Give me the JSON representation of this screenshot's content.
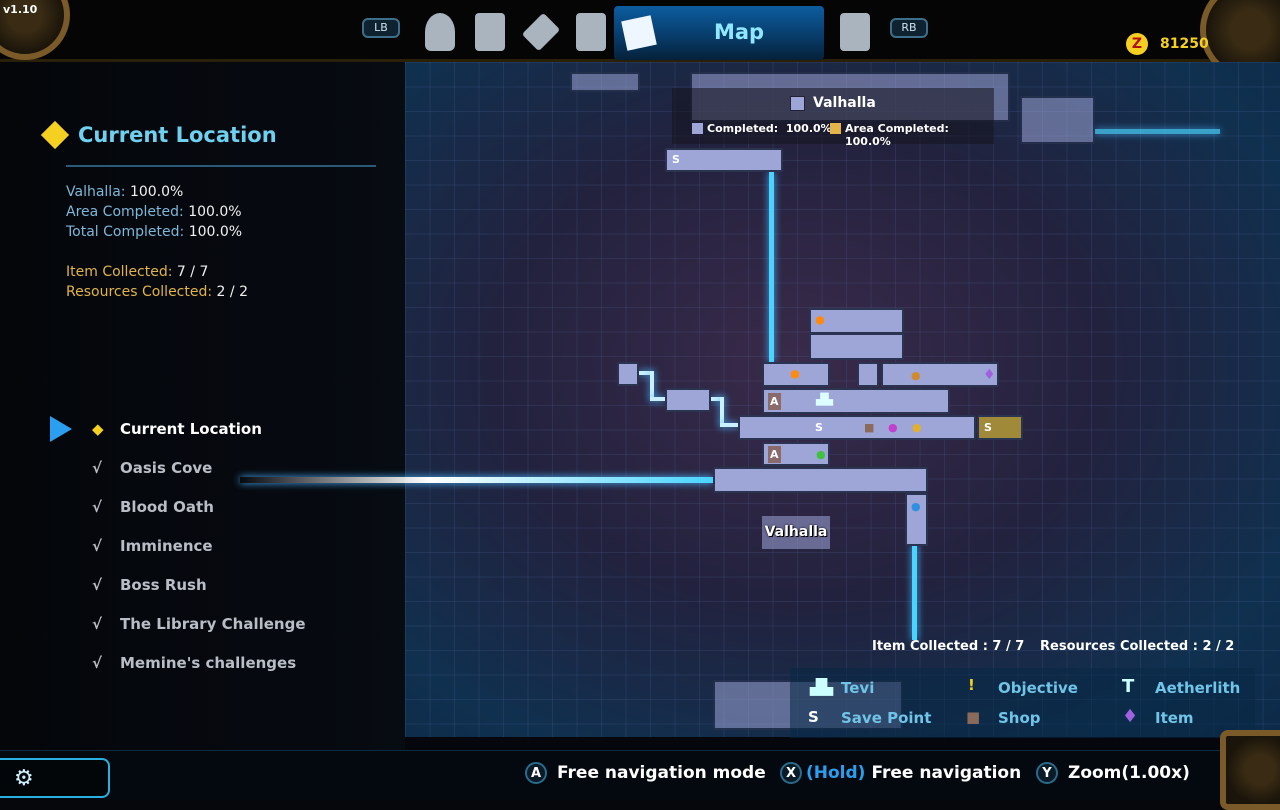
{
  "version": "v1.10",
  "nav": {
    "lb": "LB",
    "rb": "RB",
    "active_tab": "Map",
    "tabs": [
      "profile-icon",
      "skills-icon",
      "wrench-icon",
      "scroll-icon",
      "map-icon",
      "bestiary-book-icon"
    ]
  },
  "currency": {
    "amount": "81250",
    "icon": "zenny-coin-icon",
    "color": "#f5d020"
  },
  "current_location": {
    "title": "Current Location",
    "area_label": "Valhalla:",
    "area_value": "100.0%",
    "area_completed_label": "Area Completed:",
    "area_completed_value": "100.0%",
    "total_completed_label": "Total Completed:",
    "total_completed_value": "100.0%",
    "item_label": "Item Collected:",
    "item_value": "7 / 7",
    "resources_label": "Resources Collected:",
    "resources_value": "2 / 2"
  },
  "menu": {
    "items": [
      {
        "label": "Current Location",
        "mark": "◆",
        "selected": true
      },
      {
        "label": "Oasis Cove",
        "mark": "√"
      },
      {
        "label": "Blood Oath",
        "mark": "√"
      },
      {
        "label": "Imminence",
        "mark": "√"
      },
      {
        "label": "Boss Rush",
        "mark": "√"
      },
      {
        "label": "The Library Challenge",
        "mark": "√"
      },
      {
        "label": "Memine's challenges",
        "mark": "√"
      }
    ]
  },
  "map": {
    "area_name": "Valhalla",
    "completed_label": "Completed:",
    "completed_value": "100.0%",
    "area_completed_label": "Area Completed:",
    "area_completed_value": "100.0%",
    "room_label": "Valhalla",
    "room_color": "#9ea6d8",
    "area_color": "#e2b44a",
    "item_collected": "Item Collected : 7 / 7",
    "resources_collected": "Resources Collected : 2 / 2",
    "save_glyph": "S",
    "door_glyph": "A"
  },
  "legend": [
    {
      "label": "Tevi",
      "icon": "tevi-bunny-icon"
    },
    {
      "label": "Objective",
      "icon": "exclamation-icon"
    },
    {
      "label": "Aetherlith",
      "icon": "aetherlith-t-icon"
    },
    {
      "label": "Save Point",
      "icon": "save-point-icon"
    },
    {
      "label": "Shop",
      "icon": "shop-bag-icon"
    },
    {
      "label": "Item",
      "icon": "item-crystal-icon"
    }
  ],
  "hints": [
    {
      "button": "A",
      "label": "Free navigation mode"
    },
    {
      "button": "X",
      "hold": "(Hold)",
      "label": "Free navigation"
    },
    {
      "button": "Y",
      "label": "Zoom(1.00x)"
    }
  ]
}
